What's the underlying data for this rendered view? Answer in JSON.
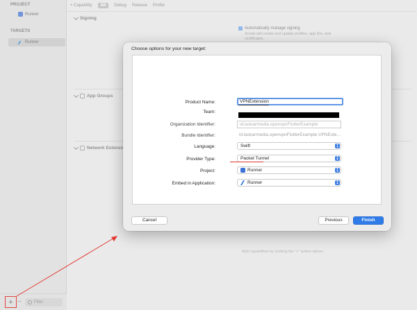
{
  "sidebar": {
    "project_header": "PROJECT",
    "project_item": "Runner",
    "targets_header": "TARGETS",
    "target_item": "Runner",
    "add_button": "+",
    "remove_button": "−",
    "filter_placeholder": "Filter"
  },
  "toolbar": {
    "add_capability": "+ Capability",
    "tabs": [
      "All",
      "Debug",
      "Release",
      "Profile"
    ]
  },
  "capabilities": {
    "signing": "Signing",
    "auto_manage": "Automatically manage signing",
    "auto_manage_sub": "Xcode will create and update profiles, app IDs, and certificates.",
    "app_groups": "App Groups",
    "network_extension": "Network Extensio",
    "hint": "Add capabilities by clicking the \"+\" button above."
  },
  "dialog": {
    "title": "Choose options for your new target:",
    "product_name_label": "Product Name:",
    "product_name_value": "VPNExtension",
    "team_label": "Team:",
    "org_id_label": "Organization Identifier:",
    "org_id_value": "id.laskarmedia.openvpnFlutterExample",
    "bundle_id_label": "Bundle Identifier:",
    "bundle_id_value": "id.laskarmedia.openvpnFlutterExample.VPNExte...",
    "language_label": "Language:",
    "language_value": "Swift",
    "provider_type_label": "Provider Type:",
    "provider_type_value": "Packet Tunnel",
    "project_label": "Project:",
    "project_value": "Runner",
    "embed_label": "Embed in Application:",
    "embed_value": "Runner",
    "cancel": "Cancel",
    "previous": "Previous",
    "finish": "Finish"
  },
  "colors": {
    "accent": "#2f7be8",
    "annotation_red": "#e13a33"
  }
}
